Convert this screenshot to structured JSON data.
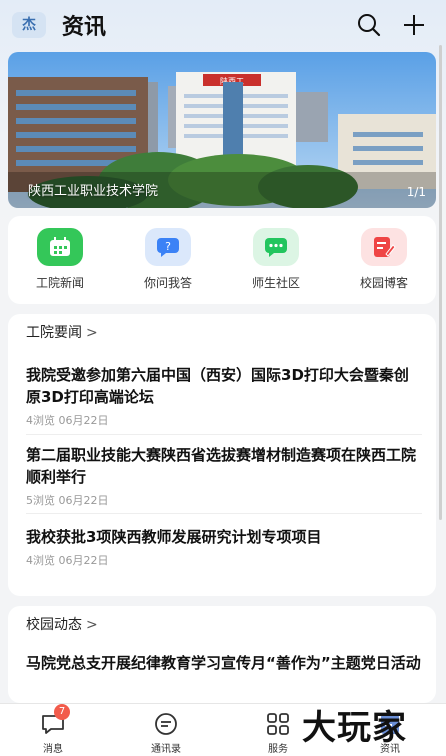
{
  "app": {
    "logo_char": "杰",
    "title": "资讯"
  },
  "banner": {
    "caption": "陕西工业职业技术学院",
    "page_indicator": "1/1",
    "building_sign": "陕西工"
  },
  "shortcuts": [
    {
      "label": "工院新闻",
      "icon": "calendar-icon",
      "color": "#34c759"
    },
    {
      "label": "你问我答",
      "icon": "question-chat-icon",
      "color": "#3b82f6"
    },
    {
      "label": "师生社区",
      "icon": "chat-bubble-icon",
      "color": "#22c55e"
    },
    {
      "label": "校园博客",
      "icon": "edit-note-icon",
      "color": "#ef4444"
    }
  ],
  "sections": [
    {
      "title": "工院要闻",
      "items": [
        {
          "title": "我院受邀参加第六届中国（西安）国际3D打印大会暨秦创原3D打印高端论坛",
          "meta": "4浏览 06月22日"
        },
        {
          "title": "第二届职业技能大赛陕西省选拔赛增材制造赛项在陕西工院顺利举行",
          "meta": "5浏览 06月22日"
        },
        {
          "title": "我校获批3项陕西教师发展研究计划专项项目",
          "meta": "4浏览 06月22日"
        }
      ]
    },
    {
      "title": "校园动态",
      "items": [
        {
          "title": "马院党总支开展纪律教育学习宣传月“善作为”主题党日活动",
          "meta": ""
        }
      ]
    }
  ],
  "tabbar": {
    "tabs": [
      {
        "label": "消息",
        "icon": "message-icon",
        "badge": "7"
      },
      {
        "label": "通讯录",
        "icon": "contacts-icon"
      },
      {
        "label": "服务",
        "icon": "grid-icon"
      },
      {
        "label": "资讯",
        "icon": "news-icon",
        "active": true
      }
    ]
  },
  "watermark": "大玩家"
}
